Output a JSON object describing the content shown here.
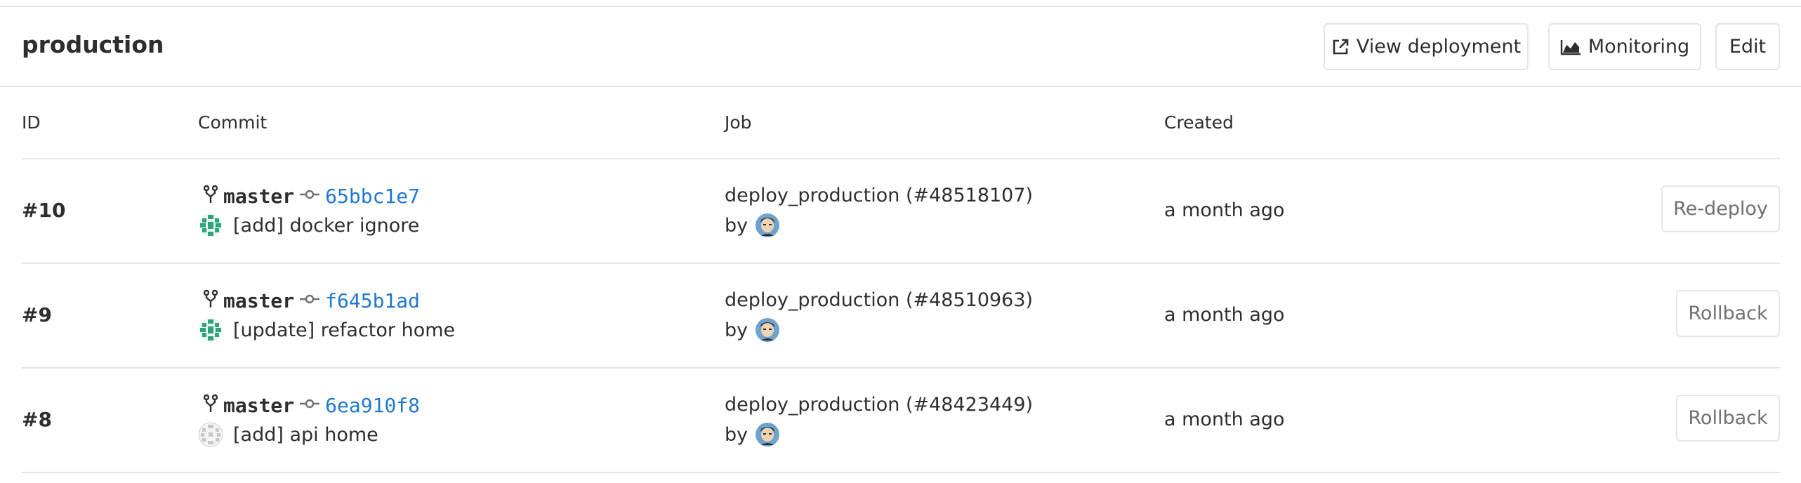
{
  "environment": {
    "name": "production",
    "actions": {
      "view_deployment": "View deployment",
      "monitoring": "Monitoring",
      "edit": "Edit"
    }
  },
  "columns": {
    "id": "ID",
    "commit": "Commit",
    "job": "Job",
    "created": "Created"
  },
  "deployments": [
    {
      "id": "#10",
      "branch": "master",
      "sha": "65bbc1e7",
      "message": "[add] docker ignore",
      "author_avatar": "identicon-green",
      "job": "deploy_production (#48518107)",
      "by": "by",
      "created": "a month ago",
      "action": "Re-deploy"
    },
    {
      "id": "#9",
      "branch": "master",
      "sha": "f645b1ad",
      "message": "[update] refactor home",
      "author_avatar": "identicon-green",
      "job": "deploy_production (#48510963)",
      "by": "by",
      "created": "a month ago",
      "action": "Rollback"
    },
    {
      "id": "#8",
      "branch": "master",
      "sha": "6ea910f8",
      "message": "[add] api home",
      "author_avatar": "identicon-grey",
      "job": "deploy_production (#48423449)",
      "by": "by",
      "created": "a month ago",
      "action": "Rollback"
    }
  ],
  "colors": {
    "link": "#1f78d1",
    "border": "#e5e5e5",
    "text": "#2e2e2e",
    "identicon_green": "#2fa37a"
  }
}
